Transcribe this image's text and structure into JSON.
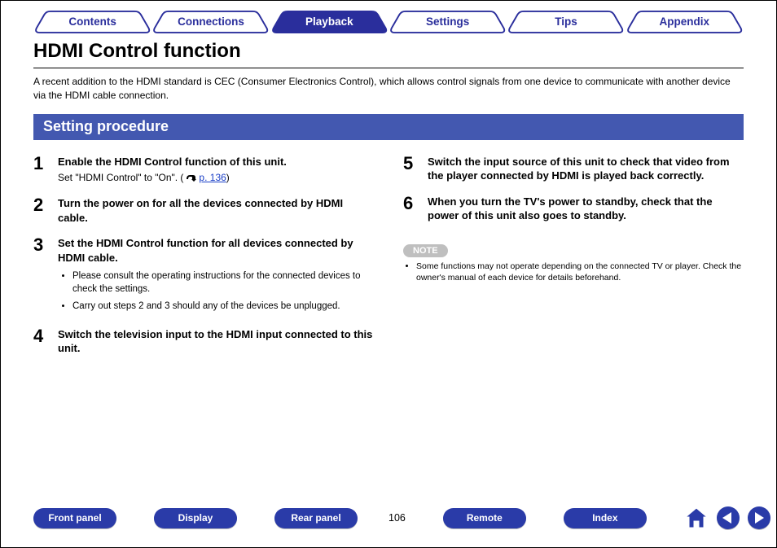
{
  "tabs": {
    "items": [
      "Contents",
      "Connections",
      "Playback",
      "Settings",
      "Tips",
      "Appendix"
    ],
    "active_index": 2
  },
  "title": "HDMI Control function",
  "intro": "A recent addition to the HDMI standard is CEC (Consumer Electronics Control), which allows control signals from one device to communicate with another device via the HDMI cable connection.",
  "section_banner": "Setting procedure",
  "steps_left": [
    {
      "n": "1",
      "head": "Enable the HDMI Control function of this unit.",
      "sub": {
        "pre": "Set \"HDMI Control\" to \"On\".  (",
        "link": "p. 136",
        "post": ")"
      }
    },
    {
      "n": "2",
      "head": "Turn the power on for all the devices connected by HDMI cable."
    },
    {
      "n": "3",
      "head": "Set the HDMI Control function for all devices connected by HDMI cable.",
      "bullets": [
        "Please consult the operating instructions for the connected devices to check the settings.",
        "Carry out steps 2 and 3 should any of the devices be unplugged."
      ]
    },
    {
      "n": "4",
      "head": "Switch the television input to the HDMI input connected to this unit."
    }
  ],
  "steps_right": [
    {
      "n": "5",
      "head": "Switch the input source of this unit to check that video from the player connected by HDMI is played back correctly."
    },
    {
      "n": "6",
      "head": "When you turn the TV's power to standby, check that the power of this unit also goes to standby."
    }
  ],
  "note": {
    "label": "NOTE",
    "items": [
      "Some functions may not operate depending on the connected TV or player. Check the owner's manual of each device for details beforehand."
    ]
  },
  "footer": {
    "pills": [
      "Front panel",
      "Display",
      "Rear panel"
    ],
    "page_number": "106",
    "pills2": [
      "Remote",
      "Index"
    ]
  }
}
